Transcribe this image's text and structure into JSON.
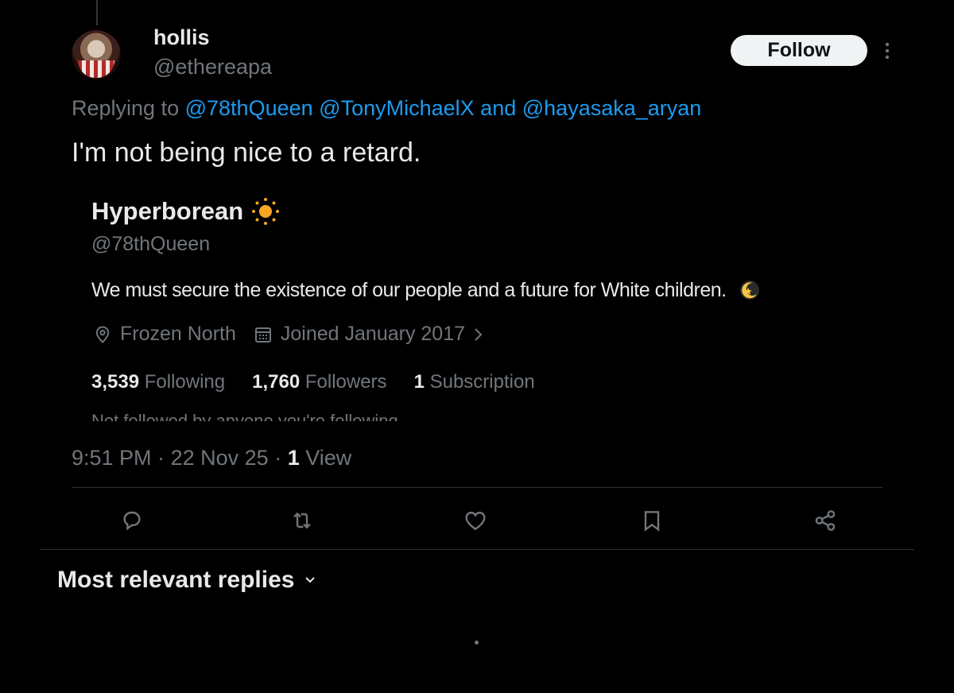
{
  "post": {
    "author_name": "hollis",
    "author_handle": "@ethereapa",
    "follow_label": "Follow",
    "replying_prefix": "Replying to",
    "replying_mention_1": "@78thQueen",
    "replying_mention_2": "@TonyMichaelX",
    "replying_and": "and",
    "replying_mention_3": "@hayasaka_aryan",
    "text": "I'm not being nice to a retard.",
    "time": "9:51 PM",
    "date": "22 Nov 25",
    "separator": "·",
    "views_count": "1",
    "views_label": "View"
  },
  "profile_card": {
    "name": "Hyperborean",
    "name_icon": "sun-emoji",
    "handle": "@78thQueen",
    "bio": "We must secure the existence of our people and a future for White children.",
    "bio_icon": "moon-star-emoji",
    "location_icon": "location-pin-icon",
    "location": "Frozen North",
    "joined_icon": "calendar-icon",
    "joined": "Joined January 2017",
    "following_count": "3,539",
    "following_label": "Following",
    "followers_count": "1,760",
    "followers_label": "Followers",
    "subscription_count": "1",
    "subscription_label": "Subscription",
    "followed_by_text": "Not followed by anyone you're following"
  },
  "actions": {
    "icons": [
      "reply-icon",
      "retweet-icon",
      "like-icon",
      "bookmark-icon",
      "share-icon"
    ]
  },
  "replies": {
    "sort_label": "Most relevant replies"
  },
  "colors": {
    "background": "#000000",
    "text_primary": "#e7e9ea",
    "text_secondary": "#71767b",
    "link": "#1d9bf0",
    "divider": "#2f3336"
  }
}
